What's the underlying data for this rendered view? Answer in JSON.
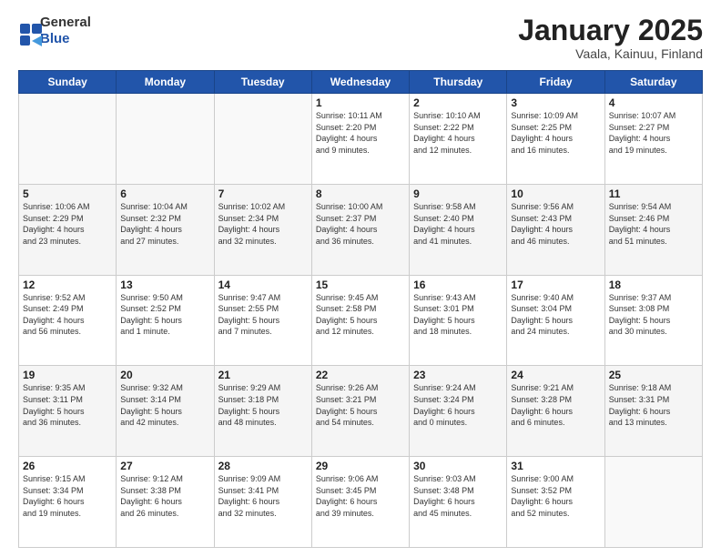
{
  "header": {
    "logo_general": "General",
    "logo_blue": "Blue",
    "title": "January 2025",
    "subtitle": "Vaala, Kainuu, Finland"
  },
  "calendar": {
    "days_of_week": [
      "Sunday",
      "Monday",
      "Tuesday",
      "Wednesday",
      "Thursday",
      "Friday",
      "Saturday"
    ],
    "weeks": [
      [
        {
          "day": "",
          "info": ""
        },
        {
          "day": "",
          "info": ""
        },
        {
          "day": "",
          "info": ""
        },
        {
          "day": "1",
          "info": "Sunrise: 10:11 AM\nSunset: 2:20 PM\nDaylight: 4 hours\nand 9 minutes."
        },
        {
          "day": "2",
          "info": "Sunrise: 10:10 AM\nSunset: 2:22 PM\nDaylight: 4 hours\nand 12 minutes."
        },
        {
          "day": "3",
          "info": "Sunrise: 10:09 AM\nSunset: 2:25 PM\nDaylight: 4 hours\nand 16 minutes."
        },
        {
          "day": "4",
          "info": "Sunrise: 10:07 AM\nSunset: 2:27 PM\nDaylight: 4 hours\nand 19 minutes."
        }
      ],
      [
        {
          "day": "5",
          "info": "Sunrise: 10:06 AM\nSunset: 2:29 PM\nDaylight: 4 hours\nand 23 minutes."
        },
        {
          "day": "6",
          "info": "Sunrise: 10:04 AM\nSunset: 2:32 PM\nDaylight: 4 hours\nand 27 minutes."
        },
        {
          "day": "7",
          "info": "Sunrise: 10:02 AM\nSunset: 2:34 PM\nDaylight: 4 hours\nand 32 minutes."
        },
        {
          "day": "8",
          "info": "Sunrise: 10:00 AM\nSunset: 2:37 PM\nDaylight: 4 hours\nand 36 minutes."
        },
        {
          "day": "9",
          "info": "Sunrise: 9:58 AM\nSunset: 2:40 PM\nDaylight: 4 hours\nand 41 minutes."
        },
        {
          "day": "10",
          "info": "Sunrise: 9:56 AM\nSunset: 2:43 PM\nDaylight: 4 hours\nand 46 minutes."
        },
        {
          "day": "11",
          "info": "Sunrise: 9:54 AM\nSunset: 2:46 PM\nDaylight: 4 hours\nand 51 minutes."
        }
      ],
      [
        {
          "day": "12",
          "info": "Sunrise: 9:52 AM\nSunset: 2:49 PM\nDaylight: 4 hours\nand 56 minutes."
        },
        {
          "day": "13",
          "info": "Sunrise: 9:50 AM\nSunset: 2:52 PM\nDaylight: 5 hours\nand 1 minute."
        },
        {
          "day": "14",
          "info": "Sunrise: 9:47 AM\nSunset: 2:55 PM\nDaylight: 5 hours\nand 7 minutes."
        },
        {
          "day": "15",
          "info": "Sunrise: 9:45 AM\nSunset: 2:58 PM\nDaylight: 5 hours\nand 12 minutes."
        },
        {
          "day": "16",
          "info": "Sunrise: 9:43 AM\nSunset: 3:01 PM\nDaylight: 5 hours\nand 18 minutes."
        },
        {
          "day": "17",
          "info": "Sunrise: 9:40 AM\nSunset: 3:04 PM\nDaylight: 5 hours\nand 24 minutes."
        },
        {
          "day": "18",
          "info": "Sunrise: 9:37 AM\nSunset: 3:08 PM\nDaylight: 5 hours\nand 30 minutes."
        }
      ],
      [
        {
          "day": "19",
          "info": "Sunrise: 9:35 AM\nSunset: 3:11 PM\nDaylight: 5 hours\nand 36 minutes."
        },
        {
          "day": "20",
          "info": "Sunrise: 9:32 AM\nSunset: 3:14 PM\nDaylight: 5 hours\nand 42 minutes."
        },
        {
          "day": "21",
          "info": "Sunrise: 9:29 AM\nSunset: 3:18 PM\nDaylight: 5 hours\nand 48 minutes."
        },
        {
          "day": "22",
          "info": "Sunrise: 9:26 AM\nSunset: 3:21 PM\nDaylight: 5 hours\nand 54 minutes."
        },
        {
          "day": "23",
          "info": "Sunrise: 9:24 AM\nSunset: 3:24 PM\nDaylight: 6 hours\nand 0 minutes."
        },
        {
          "day": "24",
          "info": "Sunrise: 9:21 AM\nSunset: 3:28 PM\nDaylight: 6 hours\nand 6 minutes."
        },
        {
          "day": "25",
          "info": "Sunrise: 9:18 AM\nSunset: 3:31 PM\nDaylight: 6 hours\nand 13 minutes."
        }
      ],
      [
        {
          "day": "26",
          "info": "Sunrise: 9:15 AM\nSunset: 3:34 PM\nDaylight: 6 hours\nand 19 minutes."
        },
        {
          "day": "27",
          "info": "Sunrise: 9:12 AM\nSunset: 3:38 PM\nDaylight: 6 hours\nand 26 minutes."
        },
        {
          "day": "28",
          "info": "Sunrise: 9:09 AM\nSunset: 3:41 PM\nDaylight: 6 hours\nand 32 minutes."
        },
        {
          "day": "29",
          "info": "Sunrise: 9:06 AM\nSunset: 3:45 PM\nDaylight: 6 hours\nand 39 minutes."
        },
        {
          "day": "30",
          "info": "Sunrise: 9:03 AM\nSunset: 3:48 PM\nDaylight: 6 hours\nand 45 minutes."
        },
        {
          "day": "31",
          "info": "Sunrise: 9:00 AM\nSunset: 3:52 PM\nDaylight: 6 hours\nand 52 minutes."
        },
        {
          "day": "",
          "info": ""
        }
      ]
    ]
  }
}
